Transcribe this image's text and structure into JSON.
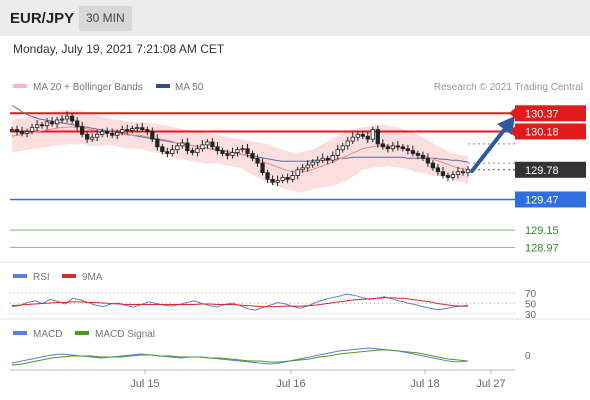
{
  "header": {
    "symbol": "EUR/JPY",
    "interval": "30 MIN",
    "timestamp": "Monday, July 19, 2021 7:21:08 AM CET"
  },
  "colors": {
    "price": "#222222",
    "bollinger_band": "#f7b7b7",
    "ma20": "#f08c8c",
    "ma50": "#5a6fa8",
    "resistance": "#e31a1a",
    "pivot": "#2f6fe0",
    "support": "#3aa83a",
    "arrow": "#2d5a9e",
    "rsi": "#5b7fd6",
    "rsi_ma": "#d62b2b",
    "macd": "#5b7fd6",
    "macd_signal": "#4a9a1f"
  },
  "legend": {
    "bollinger": "MA 20 + Bollinger Bands",
    "ma50": "MA 50",
    "rsi": "RSI",
    "rsi_ma": "9MA",
    "macd": "MACD",
    "macd_signal": "MACD Signal"
  },
  "copyright": "Research © 2021 Trading Central",
  "chart_data": [
    {
      "type": "candlestick",
      "title": "EUR/JPY",
      "x_ticks": [
        "Jul 15",
        "Jul 16",
        "Jul 18",
        "Jul 27"
      ],
      "ylim": [
        128.89,
        130.54
      ],
      "price_levels": [
        {
          "label": "130.37",
          "value": 130.37,
          "kind": "resistance"
        },
        {
          "label": "130.18",
          "value": 130.18,
          "kind": "resistance"
        },
        {
          "label": "129.78",
          "value": 129.78,
          "kind": "last"
        },
        {
          "label": "129.47",
          "value": 129.47,
          "kind": "pivot"
        },
        {
          "label": "129.15",
          "value": 129.15,
          "kind": "support"
        },
        {
          "label": "128.97",
          "value": 128.97,
          "kind": "support"
        }
      ],
      "close": [
        130.2,
        130.18,
        130.16,
        130.18,
        130.22,
        130.25,
        130.24,
        130.28,
        130.26,
        130.3,
        130.31,
        130.34,
        130.29,
        130.23,
        130.15,
        130.1,
        130.12,
        130.15,
        130.18,
        130.16,
        130.14,
        130.17,
        130.2,
        130.19,
        130.21,
        130.22,
        130.2,
        130.18,
        130.1,
        130.02,
        129.97,
        129.95,
        129.99,
        130.03,
        130.06,
        129.98,
        129.96,
        130.0,
        130.04,
        130.07,
        130.02,
        129.98,
        129.95,
        129.93,
        129.96,
        129.99,
        130.0,
        129.95,
        129.9,
        129.85,
        129.75,
        129.68,
        129.65,
        129.67,
        129.7,
        129.68,
        129.72,
        129.78,
        129.8,
        129.83,
        129.86,
        129.88,
        129.9,
        129.88,
        129.93,
        129.99,
        130.03,
        130.08,
        130.12,
        130.15,
        130.13,
        130.1,
        130.2,
        130.05,
        130.02,
        130.0,
        130.03,
        130.02,
        130.0,
        129.98,
        129.95,
        129.93,
        129.9,
        129.85,
        129.8,
        129.76,
        129.72,
        129.7,
        129.73,
        129.76,
        129.75,
        129.78
      ],
      "ma20": [
        130.13,
        130.14,
        130.15,
        130.16,
        130.17,
        130.18,
        130.19,
        130.2,
        130.21,
        130.22,
        130.22,
        130.23,
        130.22,
        130.22,
        130.21,
        130.2,
        130.19,
        130.18,
        130.18,
        130.17,
        130.16,
        130.15,
        130.14,
        130.14,
        130.14,
        130.13,
        130.12,
        130.11,
        130.1,
        130.09,
        130.08,
        130.06,
        130.05,
        130.04,
        130.03,
        130.02,
        130.01,
        130.0,
        130.0,
        129.99,
        129.98,
        129.97,
        129.96,
        129.95,
        129.93,
        129.91,
        129.89,
        129.87,
        129.85,
        129.83,
        129.81,
        129.79,
        129.77,
        129.76,
        129.75,
        129.76,
        129.77,
        129.79,
        129.81,
        129.83,
        129.85,
        129.87,
        129.9,
        129.92,
        129.95,
        129.97,
        130.0,
        130.01,
        130.02,
        130.03,
        130.03,
        130.03,
        130.02,
        130.01,
        130.0,
        129.98,
        129.96,
        129.94,
        129.92,
        129.9,
        129.88,
        129.86,
        129.84,
        129.82,
        129.8,
        129.79,
        129.78
      ],
      "bollinger_upper": [
        130.3,
        130.31,
        130.32,
        130.33,
        130.34,
        130.36,
        130.37,
        130.38,
        130.39,
        130.4,
        130.4,
        130.41,
        130.4,
        130.39,
        130.38,
        130.37,
        130.35,
        130.33,
        130.32,
        130.31,
        130.3,
        130.29,
        130.28,
        130.28,
        130.28,
        130.27,
        130.27,
        130.26,
        130.25,
        130.24,
        130.23,
        130.22,
        130.21,
        130.2,
        130.19,
        130.18,
        130.17,
        130.16,
        130.15,
        130.14,
        130.13,
        130.12,
        130.11,
        130.1,
        130.09,
        130.08,
        130.07,
        130.06,
        130.05,
        130.03,
        130.01,
        129.99,
        129.97,
        129.96,
        129.96,
        129.97,
        129.98,
        130.0,
        130.03,
        130.06,
        130.09,
        130.12,
        130.15,
        130.18,
        130.2,
        130.21,
        130.22,
        130.23,
        130.24,
        130.25,
        130.25,
        130.24,
        130.23,
        130.22,
        130.2,
        130.18,
        130.16,
        130.13,
        130.1,
        130.07,
        130.04,
        130.01,
        129.98,
        129.96,
        129.94,
        129.93,
        129.93
      ],
      "bollinger_lower": [
        129.96,
        129.97,
        129.98,
        129.99,
        130.0,
        130.0,
        130.01,
        130.02,
        130.03,
        130.04,
        130.04,
        130.05,
        130.04,
        130.05,
        130.04,
        130.03,
        130.03,
        130.03,
        130.04,
        130.03,
        130.02,
        130.01,
        130.0,
        130.0,
        130.0,
        129.99,
        129.97,
        129.96,
        129.95,
        129.94,
        129.93,
        129.9,
        129.89,
        129.88,
        129.87,
        129.86,
        129.85,
        129.84,
        129.85,
        129.84,
        129.83,
        129.82,
        129.81,
        129.8,
        129.77,
        129.74,
        129.71,
        129.68,
        129.65,
        129.63,
        129.61,
        129.59,
        129.57,
        129.56,
        129.54,
        129.55,
        129.56,
        129.58,
        129.59,
        129.6,
        129.61,
        129.62,
        129.65,
        129.66,
        129.7,
        129.73,
        129.78,
        129.79,
        129.8,
        129.81,
        129.81,
        129.82,
        129.81,
        129.8,
        129.8,
        129.78,
        129.76,
        129.75,
        129.74,
        129.73,
        129.72,
        129.71,
        129.7,
        129.68,
        129.66,
        129.65,
        129.63
      ],
      "ma50": [
        130.45,
        130.42,
        130.38,
        130.35,
        130.33,
        130.31,
        130.3,
        130.29,
        130.28,
        130.27,
        130.26,
        130.25,
        130.24,
        130.23,
        130.22,
        130.21,
        130.2,
        130.19,
        130.18,
        130.17,
        130.16,
        130.15,
        130.14,
        130.13,
        130.12,
        130.11,
        130.1,
        130.09,
        130.08,
        130.07,
        130.06,
        130.05,
        130.04,
        130.03,
        130.02,
        130.01,
        130.0,
        129.99,
        129.98,
        129.97,
        129.96,
        129.95,
        129.94,
        129.93,
        129.92,
        129.91,
        129.9,
        129.89,
        129.88,
        129.87,
        129.87,
        129.87,
        129.87,
        129.87,
        129.87,
        129.88,
        129.88,
        129.88,
        129.89,
        129.89,
        129.9,
        129.9,
        129.91,
        129.91,
        129.91,
        129.91,
        129.91,
        129.91,
        129.91,
        129.91,
        129.91,
        129.91,
        129.9,
        129.9,
        129.9,
        129.9,
        129.9,
        129.9,
        129.89,
        129.89,
        129.88,
        129.88,
        129.87,
        129.86
      ]
    },
    {
      "type": "line",
      "title": "RSI",
      "y_ticks": [
        "70",
        "50",
        "30"
      ],
      "ylim": [
        22,
        78
      ],
      "series": [
        {
          "name": "RSI",
          "values": [
            44,
            46,
            52,
            55,
            50,
            58,
            54,
            49,
            60,
            57,
            52,
            47,
            44,
            49,
            51,
            46,
            43,
            48,
            53,
            50,
            47,
            45,
            48,
            52,
            55,
            50,
            46,
            43,
            48,
            51,
            46,
            40,
            37,
            42,
            47,
            52,
            49,
            44,
            41,
            46,
            52,
            57,
            61,
            64,
            68,
            66,
            62,
            58,
            60,
            63,
            59,
            55,
            51,
            48,
            44,
            41,
            38,
            40,
            43,
            45,
            47
          ]
        },
        {
          "name": "9MA",
          "values": [
            46,
            47,
            48,
            49,
            50,
            51,
            52,
            52,
            53,
            53,
            52,
            52,
            51,
            50,
            49,
            48,
            48,
            48,
            48,
            48,
            48,
            48,
            48,
            48,
            48,
            49,
            49,
            48,
            48,
            48,
            47,
            46,
            45,
            44,
            44,
            44,
            45,
            45,
            45,
            46,
            47,
            49,
            51,
            53,
            55,
            57,
            58,
            59,
            60,
            61,
            61,
            60,
            59,
            57,
            55,
            53,
            50,
            48,
            46,
            45,
            45
          ]
        }
      ]
    },
    {
      "type": "line",
      "title": "MACD",
      "y_ticks": [
        "0"
      ],
      "ylim": [
        -0.15,
        0.12
      ],
      "series": [
        {
          "name": "MACD",
          "values": [
            -0.08,
            -0.06,
            -0.04,
            -0.02,
            0.0,
            0.01,
            0.0,
            -0.01,
            -0.02,
            -0.03,
            -0.02,
            -0.01,
            0.0,
            0.01,
            0.0,
            -0.01,
            -0.02,
            -0.03,
            -0.02,
            -0.02,
            -0.03,
            -0.04,
            -0.05,
            -0.06,
            -0.07,
            -0.08,
            -0.09,
            -0.08,
            -0.06,
            -0.04,
            -0.02,
            0.0,
            0.02,
            0.04,
            0.05,
            0.06,
            0.07,
            0.06,
            0.05,
            0.04,
            0.02,
            0.0,
            -0.02,
            -0.04,
            -0.06,
            -0.07,
            -0.06
          ]
        },
        {
          "name": "MACD Signal",
          "values": [
            -0.1,
            -0.09,
            -0.07,
            -0.05,
            -0.03,
            -0.02,
            -0.01,
            -0.01,
            -0.01,
            -0.02,
            -0.02,
            -0.02,
            -0.01,
            0.0,
            0.0,
            -0.01,
            -0.01,
            -0.02,
            -0.02,
            -0.02,
            -0.03,
            -0.03,
            -0.04,
            -0.05,
            -0.06,
            -0.06,
            -0.07,
            -0.07,
            -0.06,
            -0.05,
            -0.04,
            -0.02,
            -0.01,
            0.01,
            0.02,
            0.03,
            0.04,
            0.05,
            0.05,
            0.04,
            0.03,
            0.02,
            0.0,
            -0.02,
            -0.04,
            -0.05,
            -0.06
          ]
        }
      ]
    }
  ]
}
